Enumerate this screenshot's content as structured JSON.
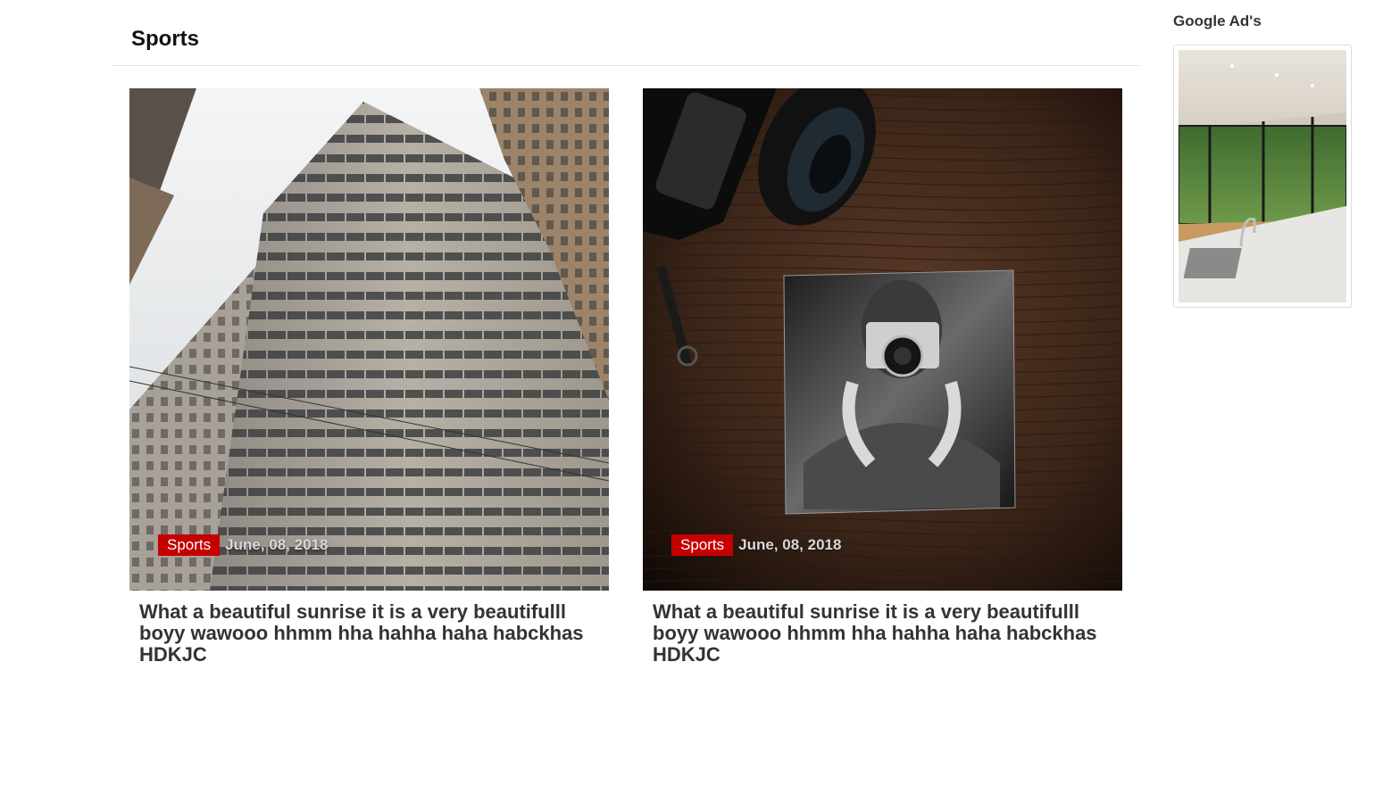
{
  "section": {
    "title": "Sports"
  },
  "posts": [
    {
      "category": "Sports",
      "date": "June, 08, 2018",
      "title": "What a beautiful sunrise it is a very beautifulll boyy wawooo hhmm hha hahha haha habckhas HDKJC",
      "image": "office-building-photo"
    },
    {
      "category": "Sports",
      "date": "June, 08, 2018",
      "title": "What a beautiful sunrise it is a very beautifulll boyy wawooo hhmm hha hahha haha habckhas HDKJC",
      "image": "camera-photo-on-table"
    }
  ],
  "sidebar": {
    "title": "Google Ad's",
    "ad_image": "modern-kitchen-photo"
  },
  "colors": {
    "badge": "#c40000",
    "title_text": "#333333",
    "divider": "#e2e2e2"
  }
}
